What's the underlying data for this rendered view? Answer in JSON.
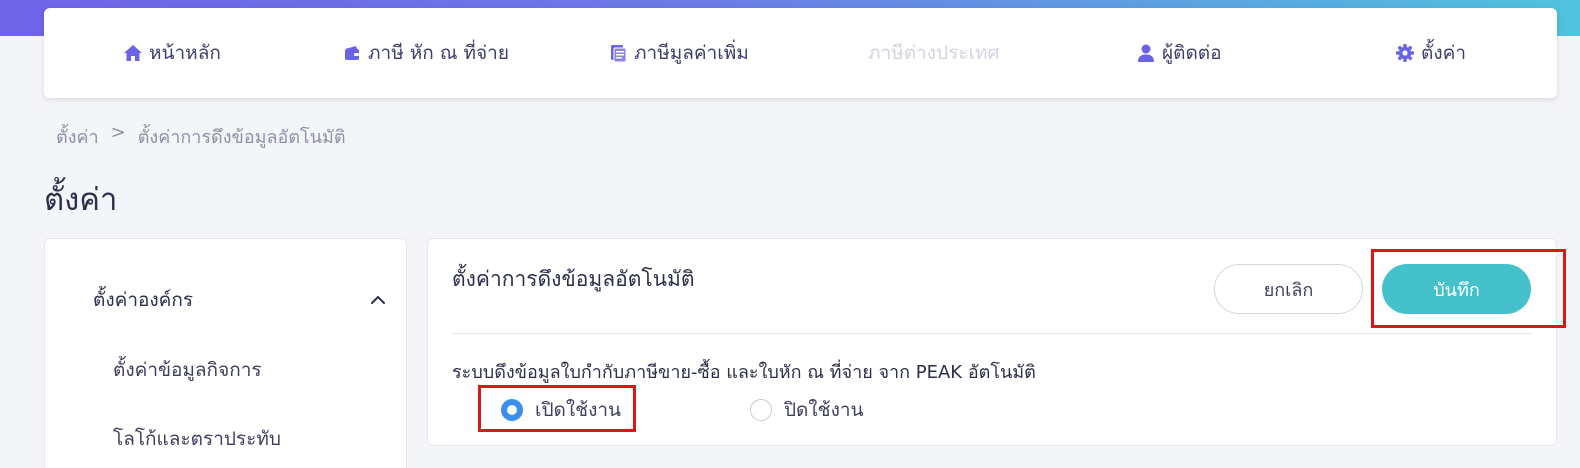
{
  "nav": {
    "items": [
      {
        "label": "หน้าหลัก",
        "icon": "home-icon",
        "disabled": false
      },
      {
        "label": "ภาษี หัก ณ ที่จ่าย",
        "icon": "wallet-icon",
        "disabled": false
      },
      {
        "label": "ภาษีมูลค่าเพิ่ม",
        "icon": "document-icon",
        "disabled": false
      },
      {
        "label": "ภาษีต่างประเทศ",
        "icon": "",
        "disabled": true
      },
      {
        "label": "ผู้ติดต่อ",
        "icon": "user-icon",
        "disabled": false
      },
      {
        "label": "ตั้งค่า",
        "icon": "gear-icon",
        "disabled": false
      }
    ]
  },
  "breadcrumb": {
    "root": "ตั้งค่า",
    "separator": ">",
    "current": "ตั้งค่าการดึงข้อมูลอัตโนมัติ"
  },
  "page": {
    "title": "ตั้งค่า"
  },
  "sidebar": {
    "group_label": "ตั้งค่าองค์กร",
    "items": [
      {
        "label": "ตั้งค่าข้อมูลกิจการ"
      },
      {
        "label": "โลโก้และตราประทับ"
      }
    ]
  },
  "panel": {
    "title": "ตั้งค่าการดึงข้อมูลอัตโนมัติ",
    "cancel_label": "ยกเลิก",
    "save_label": "บันทึก",
    "setting_label": "ระบบดึงข้อมูลใบกำกับภาษีขาย-ซื้อ และใบหัก ณ ที่จ่าย จาก PEAK อัตโนมัติ",
    "options": [
      {
        "label": "เปิดใช้งาน",
        "selected": true
      },
      {
        "label": "ปิดใช้งาน",
        "selected": false
      }
    ]
  },
  "colors": {
    "accent": "#6b63e6",
    "save_button": "#45c1cc",
    "radio_selected": "#3b8fe8",
    "highlight_box": "#e01414"
  }
}
